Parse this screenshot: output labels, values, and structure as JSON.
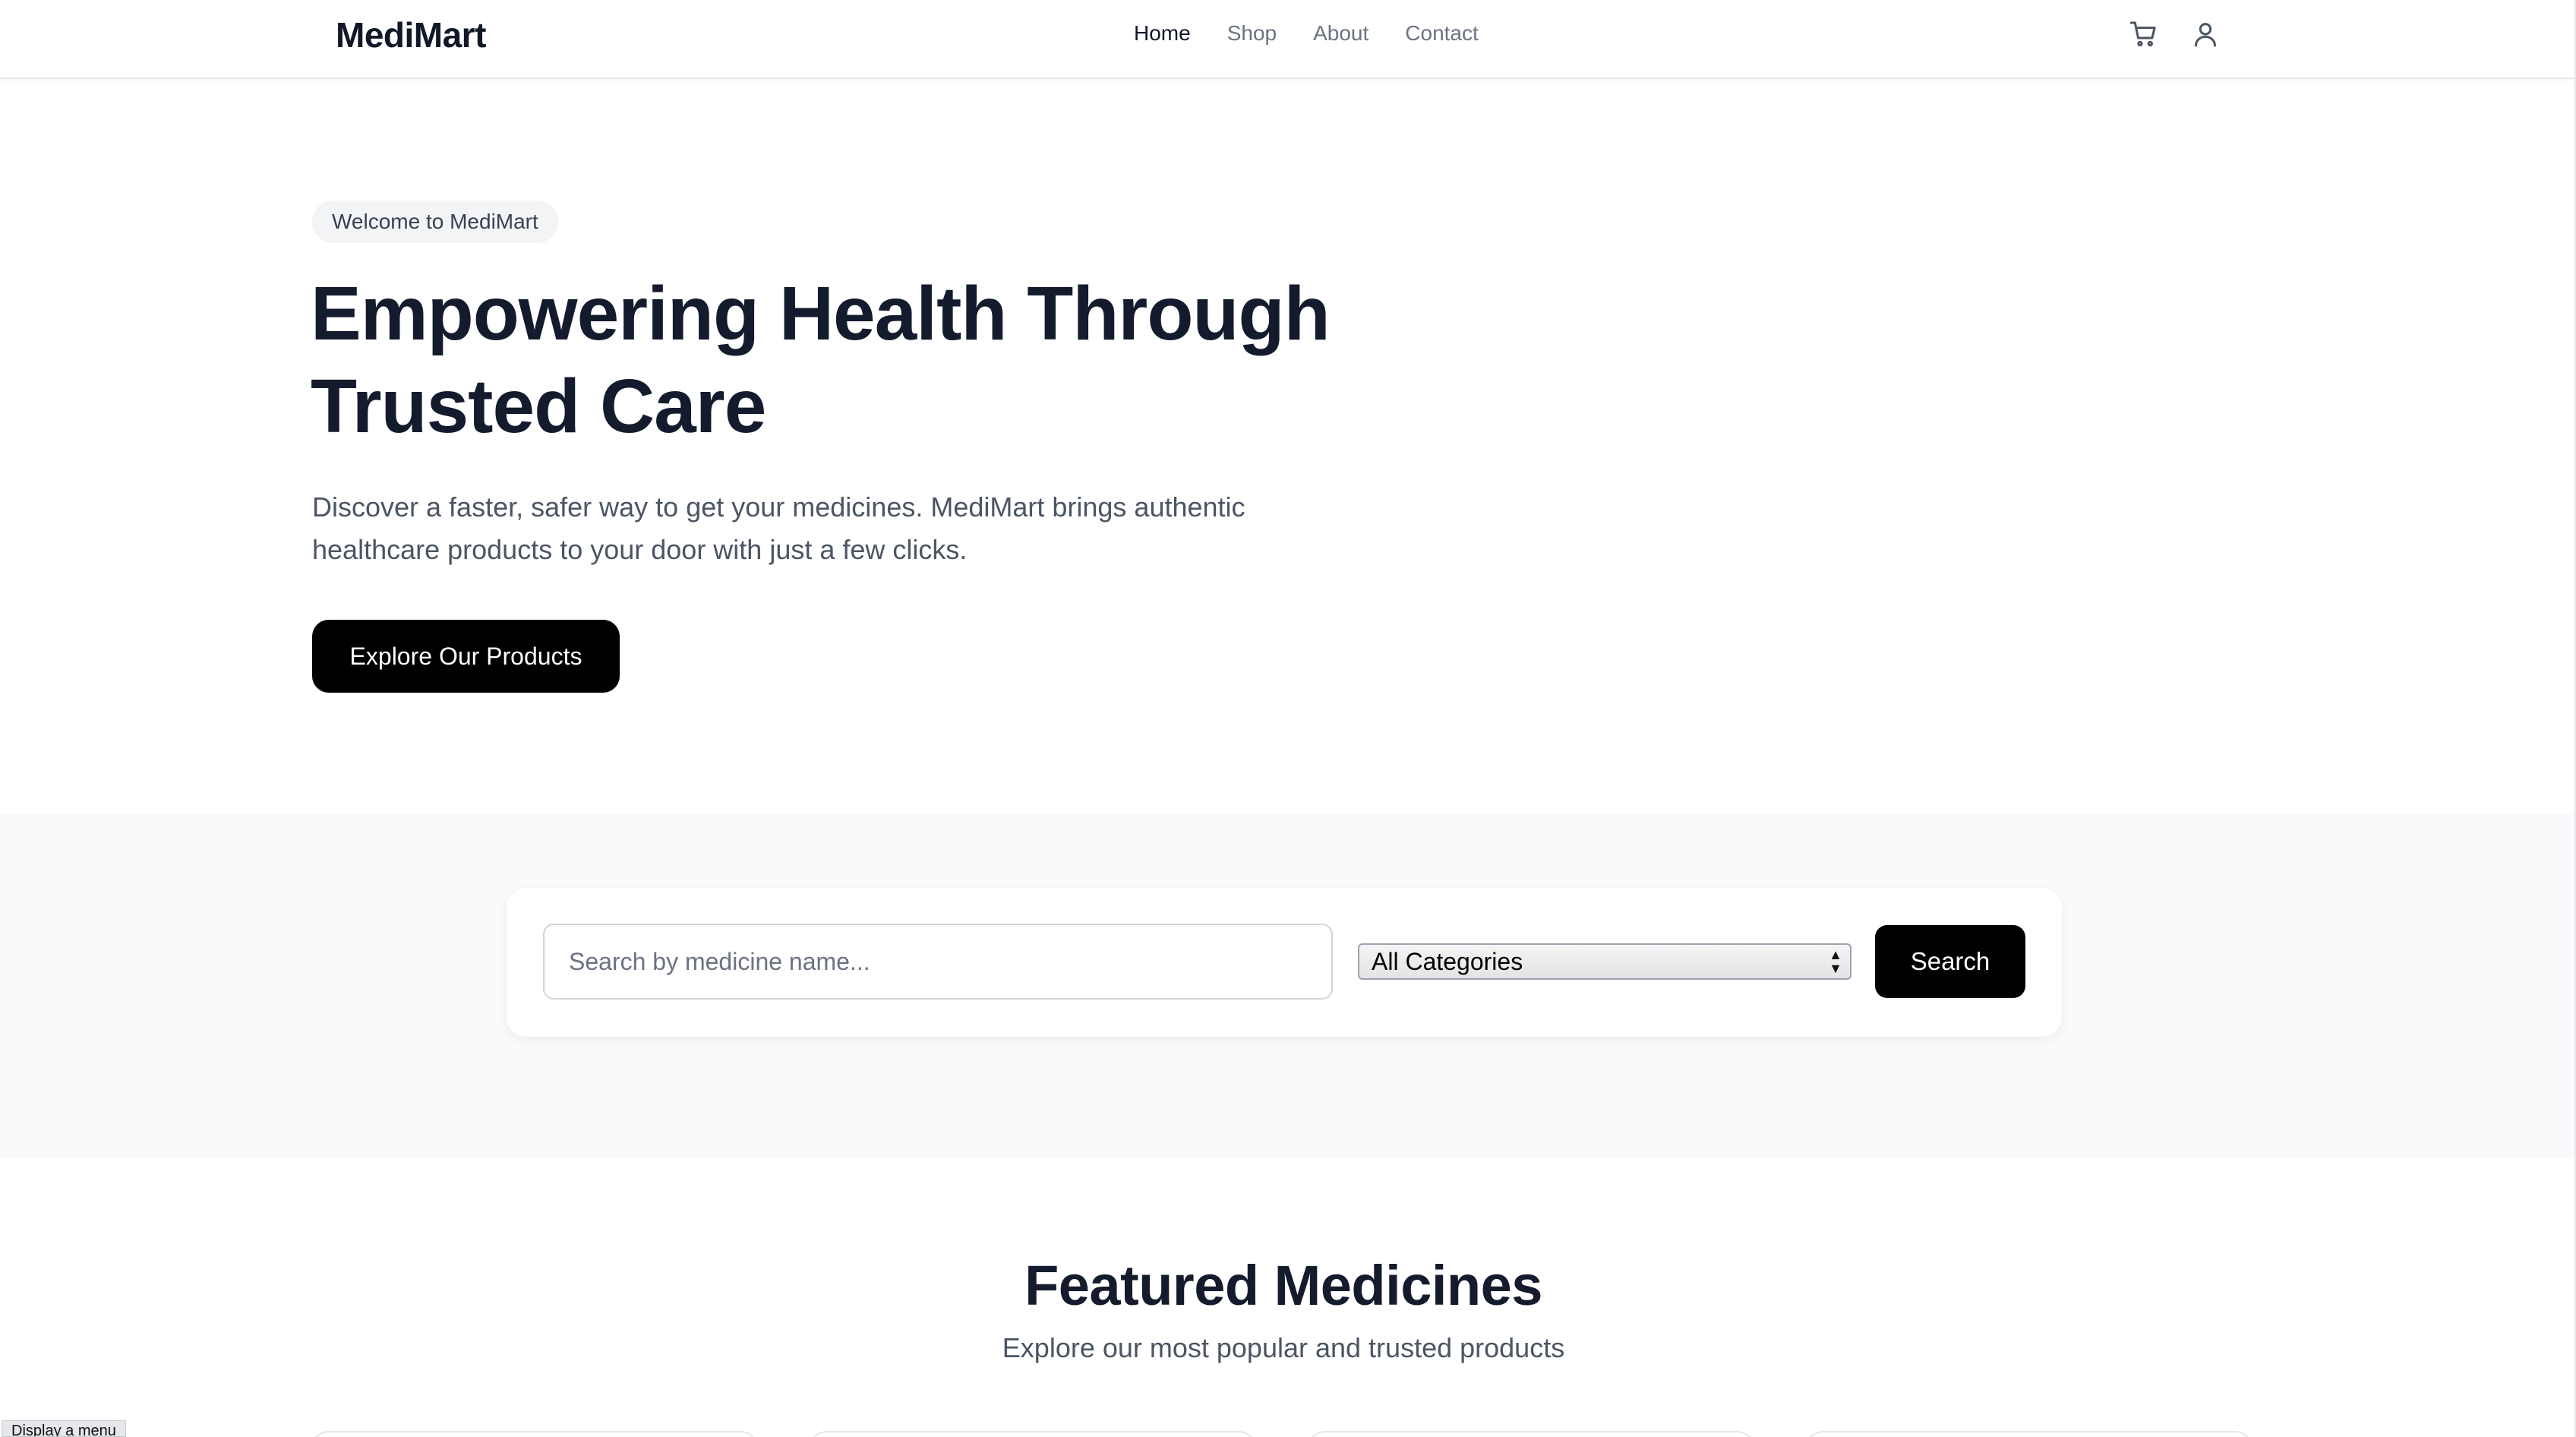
{
  "header": {
    "logo": "MediMart",
    "nav": [
      "Home",
      "Shop",
      "About",
      "Contact"
    ],
    "active_nav": "Home",
    "icons": [
      "cart-icon",
      "user-icon"
    ]
  },
  "hero": {
    "badge": "Welcome to MediMart",
    "title_line1": "Empowering Health Through",
    "title_line2": "Trusted Care",
    "description": "Discover a faster, safer way to get your medicines. MediMart brings authentic healthcare products to your door with just a few clicks.",
    "cta_label": "Explore Our Products"
  },
  "search": {
    "placeholder": "Search by medicine name...",
    "category_selected": "All Categories",
    "button_label": "Search"
  },
  "featured": {
    "title": "Featured Medicines",
    "subtitle": "Explore our most popular and trusted products"
  },
  "tooltip": "Display a menu",
  "colors": {
    "primary": "#000000",
    "heading": "#141b2d",
    "muted": "#4b5563",
    "band_bg": "#f9fafb"
  }
}
